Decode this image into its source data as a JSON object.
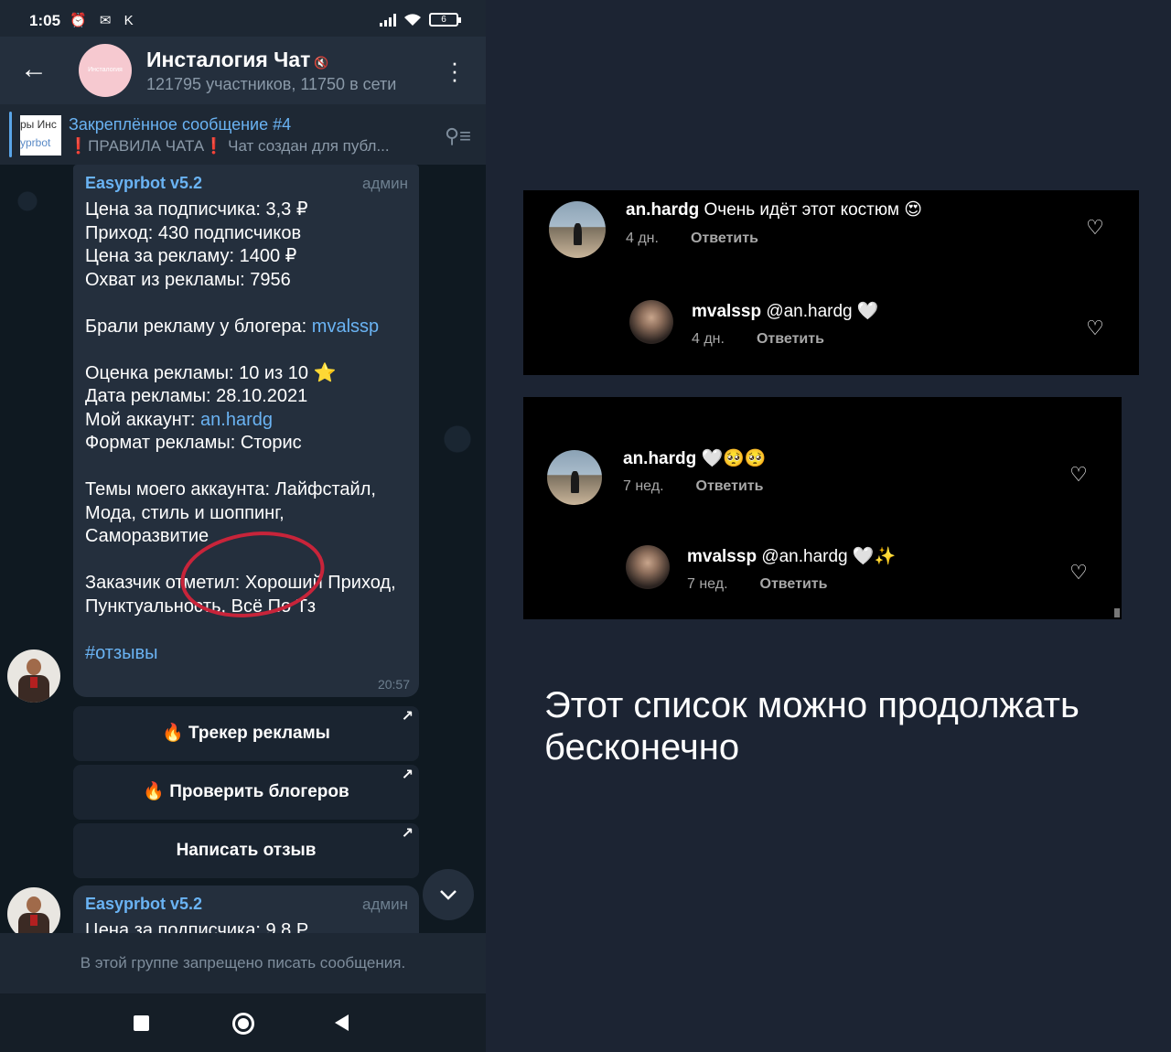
{
  "status_bar": {
    "time": "1:05",
    "left_icons": "⏰ ✉ K",
    "battery": "6"
  },
  "header": {
    "avatar_text": "Инсталогия",
    "title": "Инсталогия Чат",
    "mute_icon": "🔇",
    "subtitle": "121795 участников, 11750 в сети"
  },
  "pinned": {
    "thumb_line1": "ры Инс",
    "thumb_line2": "yprbot",
    "title": "Закреплённое сообщение #4",
    "text_emoji": "❗",
    "text_rules": "ПРАВИЛА ЧАТА",
    "text_rest": "  Чат создан для публ..."
  },
  "message_1": {
    "sender": "Easyprbot v5.2",
    "role": "админ",
    "line_price": "Цена за подписчика: 3,3 ₽",
    "line_income": "Приход: 430 подписчиков",
    "line_ad_price": "Цена за рекламу: 1400 ₽",
    "line_reach": "Охват из рекламы: 7956",
    "blogger_label": "Брали рекламу у блогера: ",
    "blogger_link": "mvalssp",
    "line_rating": "Оценка рекламы: 10 из 10 ⭐",
    "line_date": "Дата рекламы: 28.10.2021",
    "account_label": "Мой аккаунт: ",
    "account_link": "an.hardg",
    "line_format": "Формат рекламы: Сторис",
    "topics": "Темы моего аккаунта: Лайфстайл, Мода, стиль и шоппинг, Саморазвитие",
    "customer": "Заказчик отметил: Хороший Приход, Пунктуальность, Всё По Тз",
    "hashtag": "#отзывы",
    "time": "20:57"
  },
  "keyboard": {
    "btn1": "🔥 Трекер рекламы",
    "btn2": "🔥 Проверить блогеров",
    "btn3": "Написать отзыв",
    "arrow": "↗"
  },
  "message_2": {
    "sender": "Easyprbot v5.2",
    "role": "админ",
    "partial": "Цена за подписчика: 9,8 Р"
  },
  "bottom_bar": {
    "text": "В этой группе запрещено писать сообщения."
  },
  "comments_1": [
    {
      "user": "an.hardg",
      "text": " Очень идёт этот костюм 😍",
      "age": "4 дн.",
      "reply": "Ответить"
    },
    {
      "user": "mvalssp",
      "text": " @an.hardg 🤍",
      "age": "4 дн.",
      "reply": "Ответить"
    }
  ],
  "comments_2": [
    {
      "user": "an.hardg",
      "text": " 🤍🥺🥺",
      "age": "7 нед.",
      "reply": "Ответить"
    },
    {
      "user": "mvalssp",
      "text": " @an.hardg 🤍✨",
      "age": "7 нед.",
      "reply": "Ответить"
    }
  ],
  "heart_icon": "♡",
  "caption": "Этот список можно продолжать бесконечно"
}
